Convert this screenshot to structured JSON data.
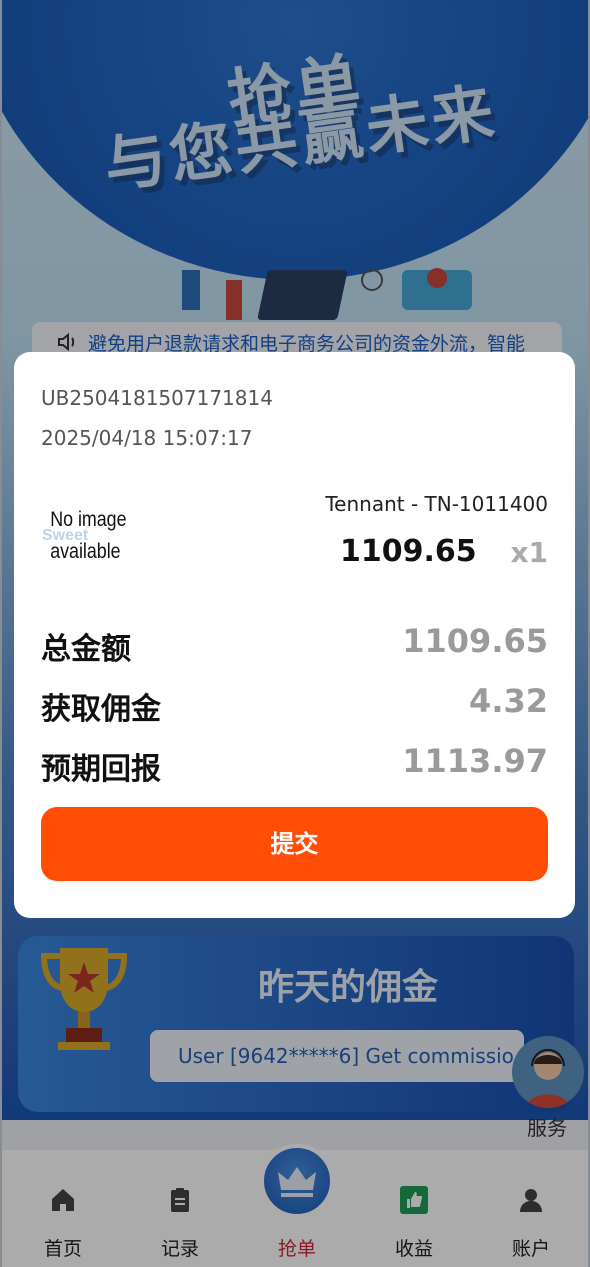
{
  "hero": {
    "slogan_line1": "抢单",
    "slogan_line2": "与您共赢未来"
  },
  "notice": {
    "text": "避免用户退款请求和电子商务公司的资金外流，智能",
    "icon": "speaker-icon"
  },
  "modal": {
    "order_id": "UB2504181507171814",
    "order_time": "2025/04/18 15:07:17",
    "image_placeholder_line1": "No image",
    "image_placeholder_line2": "available",
    "product_name": "Tennant - TN-1011400",
    "product_price": "1109.65",
    "product_qty": "x1",
    "rows": [
      {
        "label": "总金额",
        "value": "1109.65"
      },
      {
        "label": "获取佣金",
        "value": "4.32"
      },
      {
        "label": "预期回报",
        "value": "1113.97"
      }
    ],
    "submit_label": "提交"
  },
  "commission": {
    "title": "昨天的佣金",
    "ticker": "User [9642*****6] Get commissio..."
  },
  "service": {
    "label": "服务"
  },
  "tabs": [
    {
      "label": "首页",
      "icon": "home-icon"
    },
    {
      "label": "记录",
      "icon": "clipboard-icon"
    },
    {
      "label": "抢单",
      "icon": "crown-icon"
    },
    {
      "label": "收益",
      "icon": "thumbs-up-icon"
    },
    {
      "label": "账户",
      "icon": "user-icon"
    }
  ],
  "colors": {
    "accent": "#ff4d05",
    "active_tab": "#d0283a",
    "brand_blue": "#1a5cb8"
  }
}
